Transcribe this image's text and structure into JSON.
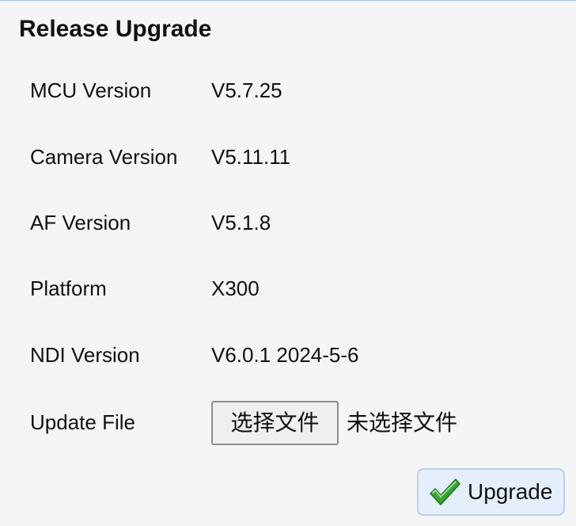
{
  "panel": {
    "title": "Release Upgrade"
  },
  "info_rows": [
    {
      "label": "MCU Version",
      "value": "V5.7.25"
    },
    {
      "label": "Camera Version",
      "value": "V5.11.11"
    },
    {
      "label": "AF Version",
      "value": "V5.1.8"
    },
    {
      "label": "Platform",
      "value": "X300"
    },
    {
      "label": "NDI Version",
      "value": "V6.0.1 2024-5-6"
    }
  ],
  "update_file": {
    "label": "Update File",
    "choose_button": "选择文件",
    "status": "未选择文件"
  },
  "upgrade_button": {
    "label": "Upgrade",
    "icon": "checkmark-icon",
    "icon_color": "#3aa33a"
  }
}
